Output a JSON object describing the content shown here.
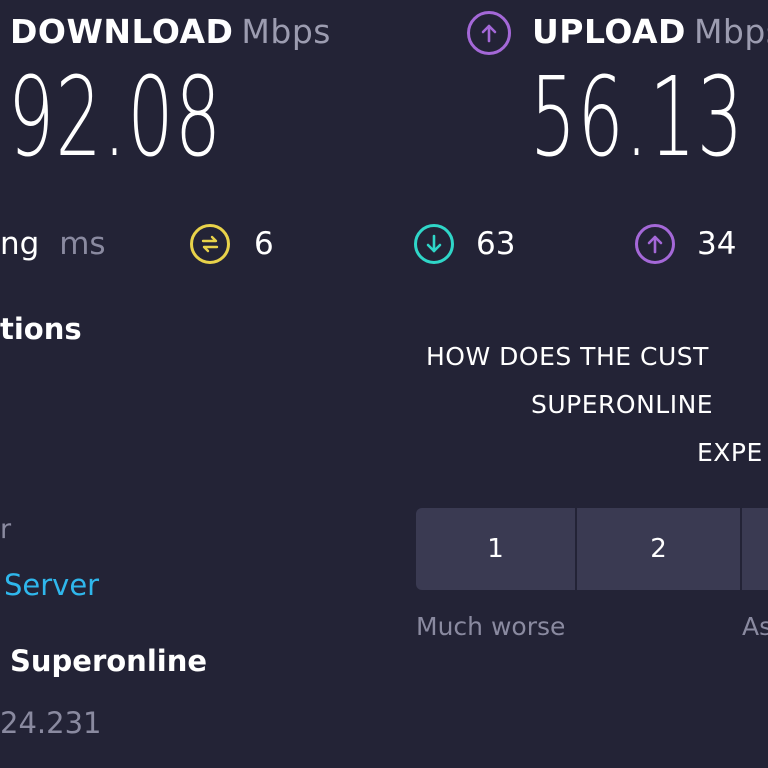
{
  "download": {
    "label": "DOWNLOAD",
    "unit": "Mbps",
    "value": "92.08",
    "icon": "download-arrow-icon",
    "color": "#2fc6d8"
  },
  "upload": {
    "label": "UPLOAD",
    "unit": "Mbps",
    "value": "56.13",
    "icon": "upload-arrow-icon",
    "color": "#a468d8"
  },
  "ping": {
    "label": "ng",
    "unit": "ms",
    "idle": "6",
    "download": "63",
    "upload": "34",
    "idle_color": "#e8d24a",
    "download_color": "#2fd6c8",
    "upload_color": "#a468d8"
  },
  "connections": {
    "title": "tions",
    "server_label": "r",
    "server_link": "Server",
    "isp": "Superonline",
    "ip": "24.231"
  },
  "survey": {
    "question_lines": [
      "HOW DOES THE CUST",
      "SUPERONLINE",
      "EXPE"
    ],
    "ratings": [
      "1",
      "2",
      ""
    ],
    "scale_low": "Much worse",
    "scale_mid": "As"
  }
}
